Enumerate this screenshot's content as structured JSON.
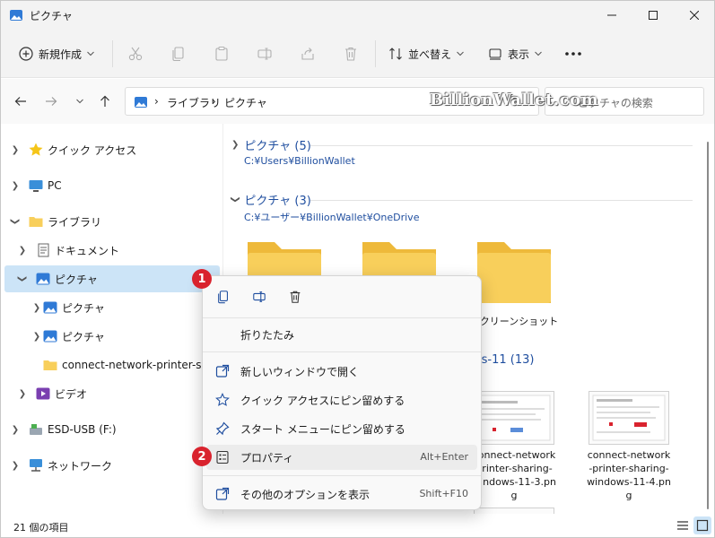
{
  "window": {
    "title": "ピクチャ"
  },
  "toolbar": {
    "new_label": "新規作成",
    "sort_label": "並べ替え",
    "view_label": "表示"
  },
  "address": {
    "crumbs": [
      "ライブラリ",
      "ピクチャ"
    ],
    "search_placeholder": "ピクチャの検索"
  },
  "watermark": "BillionWallet.com",
  "sidebar": {
    "items": [
      {
        "label": "クイック アクセス"
      },
      {
        "label": "PC"
      },
      {
        "label": "ライブラリ"
      },
      {
        "label": "ドキュメント"
      },
      {
        "label": "ピクチャ"
      },
      {
        "label": "ピクチャ"
      },
      {
        "label": "ピクチャ"
      },
      {
        "label": "connect-network-printer-sharing"
      },
      {
        "label": "ビデオ"
      },
      {
        "label": "ESD-USB (F:)"
      },
      {
        "label": "ネットワーク"
      }
    ]
  },
  "content": {
    "group1": {
      "title": "ピクチャ (5)",
      "path": "C:¥Users¥BillionWallet"
    },
    "group2": {
      "title": "ピクチャ (3)",
      "path": "C:¥ユーザー¥BillionWallet¥OneDrive"
    },
    "folder3_label": "スクリーンショット",
    "group3_title": "ws-11 (13)",
    "files": [
      {
        "label": "connect-network-printer-sharing-windows-11-3.png",
        "line1": "connect-network",
        "line2": "printer-sharing-",
        "line3": "windows-11-3.pn",
        "line4": "g"
      },
      {
        "label": "connect-network-printer-sharing-windows-11-4.png",
        "line1": "connect-network",
        "line2": "-printer-sharing-",
        "line3": "windows-11-4.pn",
        "line4": "g"
      }
    ]
  },
  "context_menu": {
    "collapse": "折りたたみ",
    "open_new_window": "新しいウィンドウで開く",
    "pin_quick_access": "クイック アクセスにピン留めする",
    "pin_start": "スタート メニューにピン留めする",
    "properties": "プロパティ",
    "properties_shortcut": "Alt+Enter",
    "more_options": "その他のオプションを表示",
    "more_options_shortcut": "Shift+F10"
  },
  "badges": {
    "one": "1",
    "two": "2"
  },
  "status": {
    "count": "21 個の項目"
  },
  "colors": {
    "accent": "#0067c0",
    "selected": "#cce4f7",
    "badge": "#d9232e",
    "folder": "#f8cf5b"
  }
}
